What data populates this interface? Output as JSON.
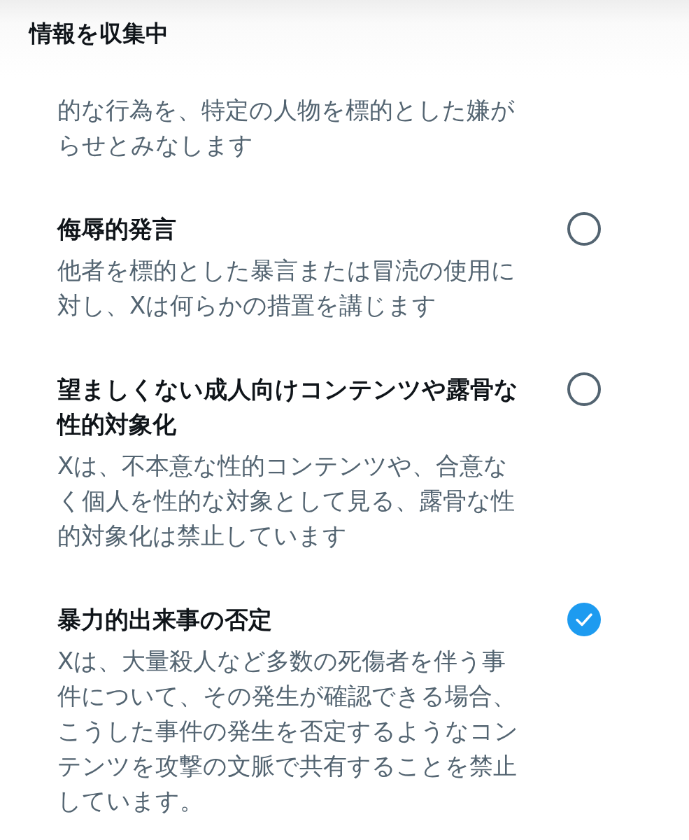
{
  "header": {
    "title": "情報を収集中"
  },
  "cut_off_description": "的な行為を、特定の人物を標的とした嫌がらせとみなします",
  "options": [
    {
      "title": "侮辱的発言",
      "description": "他者を標的とした暴言または冒涜の使用に対し、Xは何らかの措置を講じます",
      "selected": false
    },
    {
      "title": "望ましくない成人向けコンテンツや露骨な性的対象化",
      "description": "Xは、不本意な性的コンテンツや、合意なく個人を性的な対象として見る、露骨な性的対象化は禁止しています",
      "selected": false
    },
    {
      "title": "暴力的出来事の否定",
      "description": "Xは、大量殺人など多数の死傷者を伴う事件について、その発生が確認できる場合、こうした事件の発生を否定するようなコンテンツを攻撃の文脈で共有することを禁止しています。",
      "selected": true
    }
  ]
}
